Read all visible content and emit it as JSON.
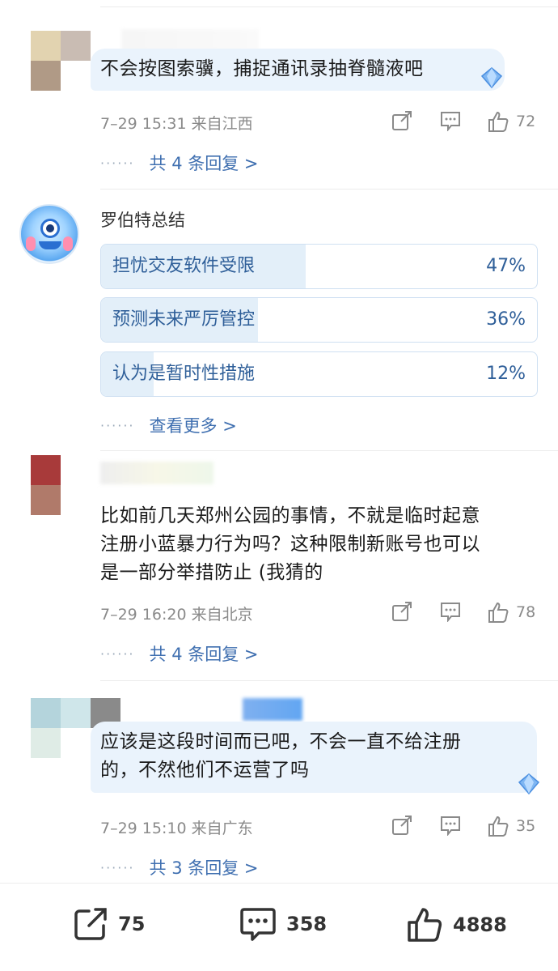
{
  "comments": [
    {
      "text_lines": [
        "不会按图索骥，捕捉通讯录抽脊髓液吧"
      ],
      "meta": "7–29 15:31 来自江西",
      "likes": "72",
      "replies": "共 4 条回复 >"
    },
    {
      "text_lines": [
        "比如前几天郑州公园的事情，不就是临时起意",
        "注册小蓝暴力行为吗？这种限制新账号也可以",
        "是一部分举措防止 (我猜的"
      ],
      "meta": "7–29 16:20 来自北京",
      "likes": "78",
      "replies": "共 4 条回复 >"
    },
    {
      "text_lines": [
        "应该是这段时间而已吧，不会一直不给注册",
        "的，不然他们不运营了吗"
      ],
      "meta": "7–29 15:10 来自广东",
      "likes": "35",
      "replies": "共 3 条回复 >"
    }
  ],
  "summary": {
    "author": "罗伯特总结",
    "poll": [
      {
        "label": "担忧交友软件受限",
        "percent": "47%",
        "fill": 0.47
      },
      {
        "label": "预测未来严厉管控",
        "percent": "36%",
        "fill": 0.36
      },
      {
        "label": "认为是暂时性措施",
        "percent": "12%",
        "fill": 0.12
      }
    ],
    "more": "查看更多 >"
  },
  "bottom_bar": {
    "share": "75",
    "comments": "358",
    "likes": "4888"
  },
  "dots": "······",
  "colors": {
    "link": "#3f6fb0",
    "bubble": "#eaf3fc",
    "poll_fill": "#e3eff9",
    "meta_gray": "#8a8a8a"
  }
}
